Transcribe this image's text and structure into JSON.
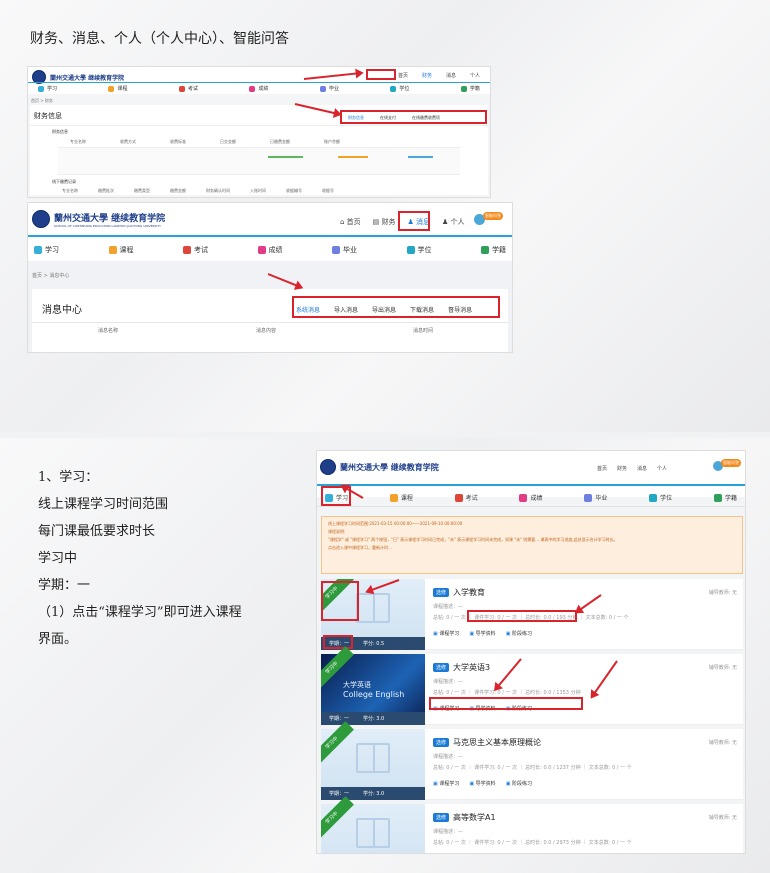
{
  "slide1": {
    "heading": "财务、消息、个人（个人中心）、智能问答"
  },
  "shot_finance": {
    "logo": "蘭州交通大學 继续教育学院",
    "topnav": [
      "首页",
      "财务",
      "消息",
      "个人"
    ],
    "mainnav": [
      "学习",
      "课程",
      "考试",
      "成绩",
      "毕业",
      "学位",
      "学籍"
    ],
    "breadcrumb": "首页 > 财务",
    "panel_title": "财务信息",
    "tabs": [
      "财务信息",
      "在线支付",
      "在线缴费收费项"
    ],
    "section": "财务信息",
    "cols": [
      "专业名称",
      "收费方式",
      "收费标准",
      "已交金额",
      "已缴费金额",
      "账户余额"
    ],
    "section2": "线下缴费记录",
    "cols2": [
      "专业名称",
      "缴费批次",
      "缴费类型",
      "缴费金额",
      "财务确认时间",
      "入账时间",
      "收据编号",
      "收据号",
      "备注"
    ]
  },
  "shot_message": {
    "logo": "蘭州交通大學 继续教育学院",
    "logo_sub": "SCHOOL OF CONTINUING EDUCATION  LANZHOU JIAOTONG UNIVERSITY",
    "topnav": [
      "首页",
      "财务",
      "消息",
      "个人"
    ],
    "help": "智能问答",
    "mainnav": [
      "学习",
      "课程",
      "考试",
      "成绩",
      "毕业",
      "学位",
      "学籍"
    ],
    "breadcrumb": "首页 > 消息中心",
    "panel_title": "消息中心",
    "tabs": [
      "系统消息",
      "导入消息",
      "导出消息",
      "下载消息",
      "督导消息"
    ],
    "cols": [
      "消息名称",
      "消息内容",
      "消息时间"
    ]
  },
  "slide2": {
    "text": [
      "1、学习：",
      "线上课程学习时间范围",
      "每门课最低要求时长",
      "学习中",
      "学期：一",
      "（1）点击“课程学习”即可进入课程",
      "界面。"
    ]
  },
  "shot_study": {
    "logo": "蘭州交通大學 继续教育学院",
    "topnav": [
      "首页",
      "财务",
      "消息",
      "个人"
    ],
    "help": "智能问答",
    "mainnav": [
      "学习",
      "课程",
      "考试",
      "成绩",
      "毕业",
      "学位",
      "学籍"
    ],
    "notice1": "线上课程学习时间范围:2021-03-15 00:00:00——2021-09-10 00:00:00",
    "notice2": "课程说明:",
    "notice3": "\"课程学\" 或 \"课程学习\" 两个按钮，\"已\" 表示课程学习时间已完成，\"未\" 表示课程学习时间未完成，如果 \"未\" 则需要... 课表中的学习进度,此处显示合计学习时长。",
    "notice4": "点击进入课中课程学习，重新计时...",
    "courses": [
      {
        "name": "入学教育",
        "tag": "选修",
        "ribbon": "学习中",
        "term": "学期：一",
        "credit": "学分: 0.5",
        "teacher": "辅导教师: 无",
        "assign": "课程描述：—",
        "stats": "总帖: 0 / 一 次  ｜  课件学习: 0 / 一 次  ｜  总时长: 0.0 / 193 分钟  ｜  文本总数: 0 / 一 个",
        "acts": [
          "课程学习",
          "导学资料",
          "阶段练习"
        ]
      },
      {
        "name": "大学英语3",
        "tag": "选修",
        "ribbon": "学习中",
        "term": "学期：一",
        "credit": "学分: 3.0",
        "teacher": "辅导教师: 无",
        "assign": "课程描述：—",
        "stats": "总帖: 0 / 一 次  ｜  课件学习: 0 / 一 次  ｜  总时长: 0.0 / 1353 分钟",
        "acts": [
          "课程学习",
          "导学资料",
          "阶段练习"
        ],
        "cover1": "大学英语",
        "cover2": "College English"
      },
      {
        "name": "马克思主义基本原理概论",
        "tag": "选修",
        "ribbon": "学习中",
        "term": "学期：一",
        "credit": "学分: 3.0",
        "teacher": "辅导教师: 无",
        "assign": "课程描述：—",
        "stats": "总帖: 0 / 一 次  ｜  课件学习: 0 / 一 次  ｜  总时长: 0.0 / 1237 分钟  ｜  文本总数: 0 / 一 个",
        "acts": [
          "课程学习",
          "导学资料",
          "阶段练习"
        ]
      },
      {
        "name": "高等数学A1",
        "tag": "选修",
        "ribbon": "学习中",
        "term": "学期：一",
        "credit": "学分: 5.0",
        "teacher": "辅导教师: 无",
        "assign": "课程描述：—",
        "stats": "总帖: 0 / 一 次  ｜  课件学习: 0 / 一 次  ｜  总时长: 0.0 / 2973 分钟  ｜  文本总数: 0 / 一 个",
        "acts": [
          "课程学习",
          "导学资料",
          "阶段练习"
        ]
      }
    ]
  },
  "colors": {
    "accent": "#1a7ad6",
    "red": "#d9232d",
    "ribbon": "#2d9a3c"
  }
}
